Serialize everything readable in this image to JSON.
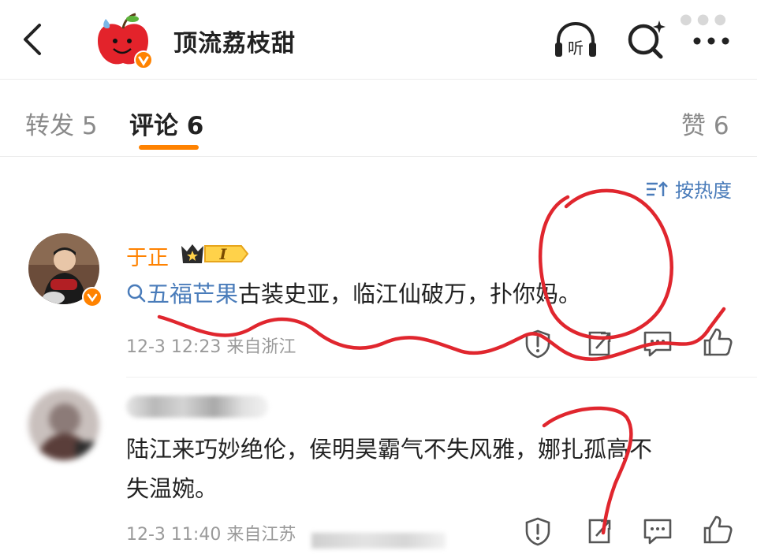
{
  "header": {
    "title": "顶流荔枝甜",
    "listen_label": "听",
    "icons": [
      "back-arrow-icon",
      "apple-avatar-icon",
      "headphones-listen-icon",
      "search-sparkle-icon",
      "more-dots-icon"
    ]
  },
  "tabs": [
    {
      "label": "转发 5"
    },
    {
      "label": "评论 6",
      "active": true
    },
    {
      "label": "赞 6"
    }
  ],
  "sort": {
    "label": "按热度"
  },
  "comments": [
    {
      "user": "于正",
      "badge_text": "I",
      "topic": "五福芒果",
      "text": "古装史亚，临江仙破万，扑你妈。",
      "time": "12-3 12:23 来自浙江",
      "actions": [
        "shield-icon",
        "share-icon",
        "comment-icon",
        "like-icon"
      ]
    },
    {
      "user": "",
      "text_line1": "陆江来巧妙绝伦，侯明昊霸气不失风雅，娜扎孤高不",
      "text_line2": "失温婉。",
      "time": "12-3 11:40 来自江苏",
      "actions": [
        "shield-icon",
        "share-icon",
        "comment-icon",
        "like-icon"
      ]
    }
  ],
  "colors": {
    "accent": "#ff8200",
    "link": "#4a7cba",
    "annotation": "#e0262e"
  }
}
